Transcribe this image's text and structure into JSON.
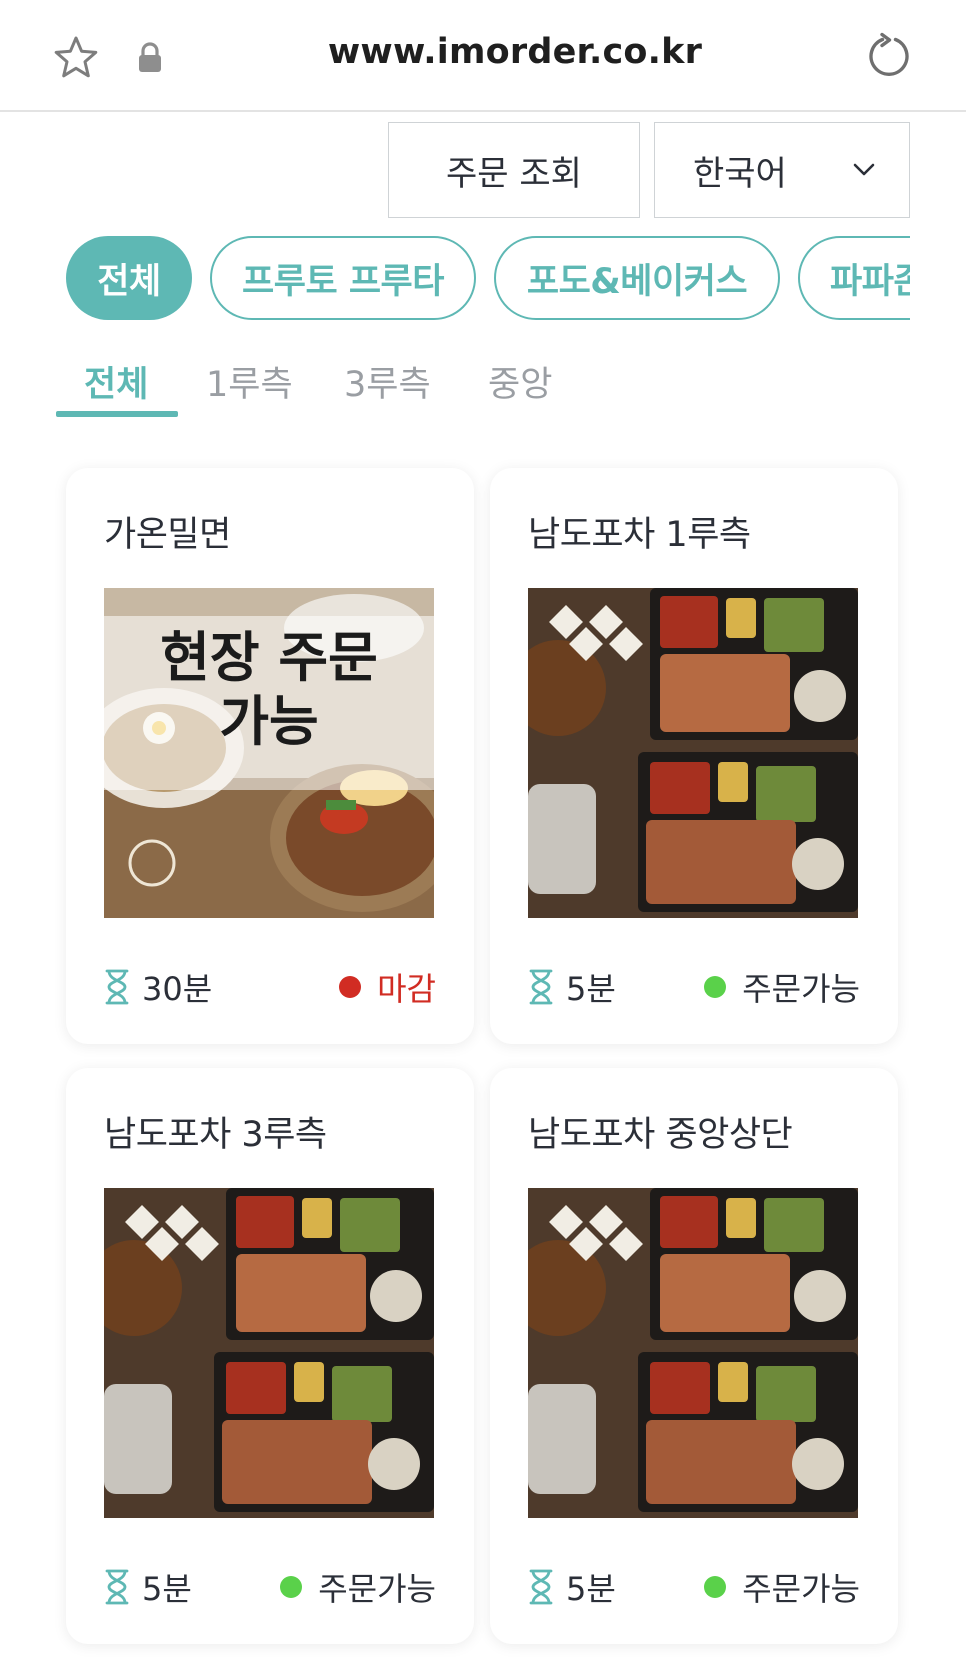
{
  "browser": {
    "url": "www.imorder.co.kr"
  },
  "header": {
    "order_lookup_label": "주문 조회",
    "language_label": "한국어"
  },
  "colors": {
    "accent": "#5eb8b4",
    "status_closed": "#d12c23",
    "status_open": "#5ad14a"
  },
  "store_chips": [
    {
      "label": "전체",
      "active": true
    },
    {
      "label": "프루토 프루타",
      "active": false
    },
    {
      "label": "포도&베이커스",
      "active": false
    },
    {
      "label": "파파존",
      "active": false
    }
  ],
  "area_tabs": [
    {
      "label": "전체",
      "active": true
    },
    {
      "label": "1루측",
      "active": false
    },
    {
      "label": "3루측",
      "active": false
    },
    {
      "label": "중앙",
      "active": false
    }
  ],
  "stores": [
    {
      "name": "가온밀면",
      "photo_overlay": "현장 주문\n가능",
      "wait_time": "30분",
      "status": "마감",
      "status_type": "closed"
    },
    {
      "name": "남도포차 1루측",
      "photo_overlay": "",
      "wait_time": "5분",
      "status": "주문가능",
      "status_type": "open"
    },
    {
      "name": "남도포차 3루측",
      "photo_overlay": "",
      "wait_time": "5분",
      "status": "주문가능",
      "status_type": "open"
    },
    {
      "name": "남도포차 중앙상단",
      "photo_overlay": "",
      "wait_time": "5분",
      "status": "주문가능",
      "status_type": "open"
    }
  ]
}
